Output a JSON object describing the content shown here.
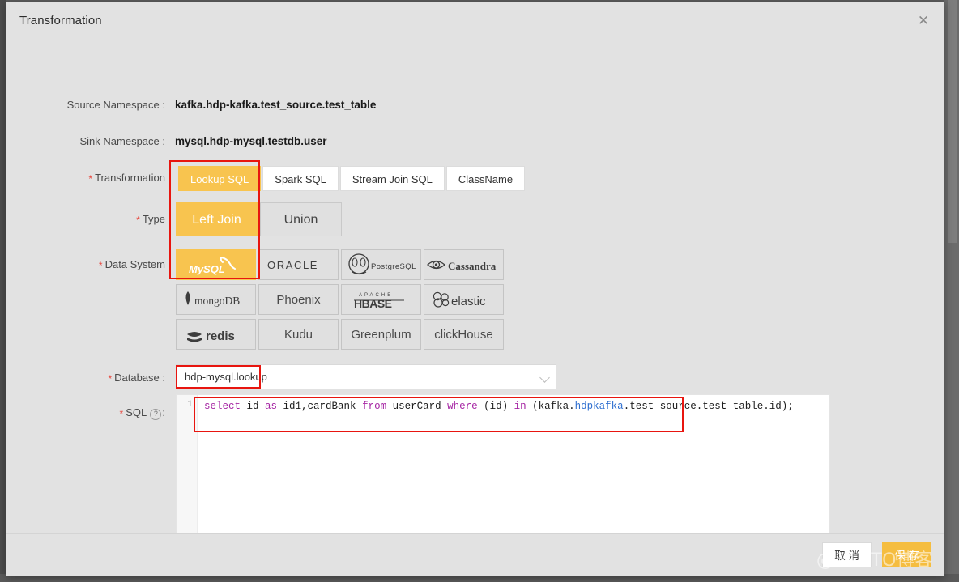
{
  "dialog": {
    "title": "Transformation",
    "close_icon": "close-icon"
  },
  "fields": {
    "source_namespace_label": "Source Namespace :",
    "source_namespace_value": "kafka.hdp-kafka.test_source.test_table",
    "sink_namespace_label": "Sink Namespace :",
    "sink_namespace_value": "mysql.hdp-mysql.testdb.user",
    "transformation_label": "Transformation",
    "type_label": "Type",
    "data_system_label": "Data System",
    "database_label": "Database :",
    "sql_label": "SQL",
    "required_marker": "*",
    "help_icon": "?",
    "colon": ":"
  },
  "transformation_options": [
    {
      "label": "Lookup SQL",
      "active": true
    },
    {
      "label": "Spark SQL",
      "active": false
    },
    {
      "label": "Stream Join SQL",
      "active": false
    },
    {
      "label": "ClassName",
      "active": false
    }
  ],
  "type_options": [
    {
      "label": "Left Join",
      "active": true
    },
    {
      "label": "Union",
      "active": false
    }
  ],
  "data_systems": [
    {
      "label": "MySQL",
      "icon": "mysql-logo",
      "active": true
    },
    {
      "label": "ORACLE",
      "icon": "oracle-logo",
      "active": false
    },
    {
      "label": "PostgreSQL",
      "icon": "postgresql-logo",
      "active": false
    },
    {
      "label": "Cassandra",
      "icon": "cassandra-logo",
      "active": false
    },
    {
      "label": "mongoDB",
      "icon": "mongodb-logo",
      "active": false
    },
    {
      "label": "Phoenix",
      "icon": "text-only",
      "active": false
    },
    {
      "label": "HBASE",
      "icon": "hbase-logo",
      "active": false
    },
    {
      "label": "elastic",
      "icon": "elastic-logo",
      "active": false
    },
    {
      "label": "redis",
      "icon": "redis-logo",
      "active": false
    },
    {
      "label": "Kudu",
      "icon": "text-only",
      "active": false
    },
    {
      "label": "Greenplum",
      "icon": "text-only",
      "active": false
    },
    {
      "label": "clickHouse",
      "icon": "text-only",
      "active": false
    }
  ],
  "database": {
    "selected": "hdp-mysql.lookup",
    "caret_icon": "chevron-down-icon"
  },
  "sql_editor": {
    "line_number": "1",
    "tokens": [
      {
        "t": "select",
        "c": "kw"
      },
      {
        "t": " id ",
        "c": "plain"
      },
      {
        "t": "as",
        "c": "kw"
      },
      {
        "t": " id1,cardBank ",
        "c": "plain"
      },
      {
        "t": "from",
        "c": "kw"
      },
      {
        "t": " userCard ",
        "c": "plain"
      },
      {
        "t": "where",
        "c": "kw"
      },
      {
        "t": " (id) ",
        "c": "plain"
      },
      {
        "t": "in",
        "c": "kw"
      },
      {
        "t": " (kafka.",
        "c": "plain"
      },
      {
        "t": "hdpkafka",
        "c": "id-blue"
      },
      {
        "t": ".test_source.test_table.id);",
        "c": "plain"
      }
    ],
    "full_text": "select id as id1,cardBank from userCard where (id) in (kafka.hdpkafka.test_source.test_table.id);"
  },
  "footer": {
    "cancel_label": "取 消",
    "save_label": "保 存"
  },
  "watermark": "@51CTO博客",
  "colors": {
    "accent": "#f8c44f",
    "annotation": "#e8150f",
    "keyword": "#a626a4",
    "identifier": "#2f6fd0"
  }
}
